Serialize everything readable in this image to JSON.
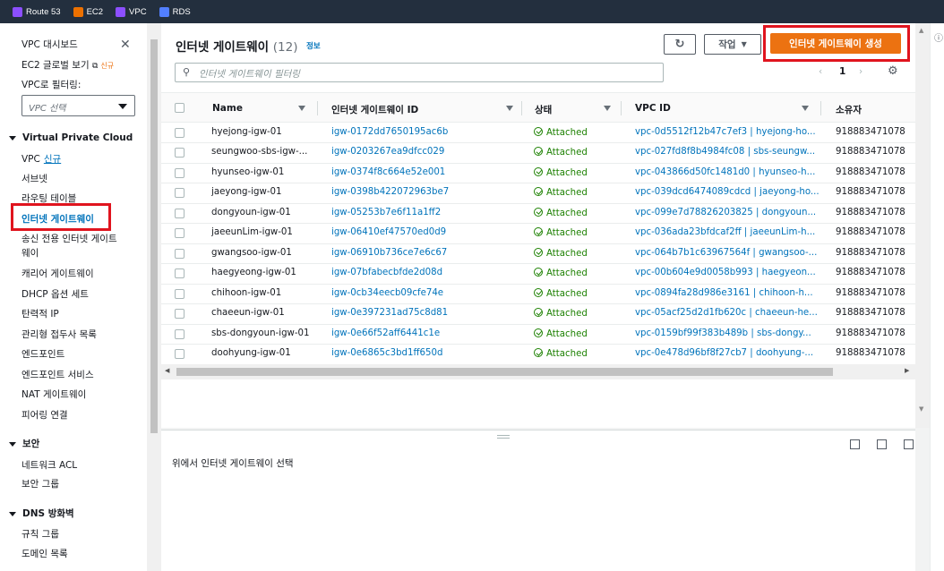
{
  "favorites": [
    {
      "label": "Route 53",
      "color": "#8c4fff",
      "icon": "route53-icon"
    },
    {
      "label": "EC2",
      "color": "#ed7100",
      "icon": "ec2-icon"
    },
    {
      "label": "VPC",
      "color": "#8c4fff",
      "icon": "vpc-icon"
    },
    {
      "label": "RDS",
      "color": "#527fff",
      "icon": "rds-icon"
    }
  ],
  "sidebar": {
    "dashboard": "VPC 대시보드",
    "global_view": "EC2 글로벌 보기",
    "global_view_badge": "신규",
    "filter_label": "VPC로 필터링:",
    "filter_select": "VPC 선택",
    "section_vpc": "Virtual Private Cloud",
    "vpc_item": "VPC",
    "vpc_new": "신규",
    "items_vpc": [
      "서브넷",
      "라우팅 테이블",
      "인터넷 게이트웨이",
      "송신 전용 인터넷 게이트",
      "웨이",
      "캐리어 게이트웨이",
      "DHCP 옵션 세트",
      "탄력적 IP",
      "관리형 접두사 목록",
      "엔드포인트",
      "엔드포인트 서비스",
      "NAT 게이트웨이",
      "피어링 연결"
    ],
    "section_security": "보안",
    "items_security": [
      "네트워크 ACL",
      "보안 그룹"
    ],
    "section_dns": "DNS 방화벽",
    "items_dns": [
      "규칙 그룹",
      "도메인 목록"
    ]
  },
  "header": {
    "title": "인터넷 게이트웨이",
    "count": "(12)",
    "info": "정보",
    "actions_label": "작업",
    "create_label": "인터넷 게이트웨이 생성",
    "search_placeholder": "인터넷 게이트웨이 필터링",
    "page": "1"
  },
  "table": {
    "columns": [
      "Name",
      "인터넷 게이트웨이 ID",
      "상태",
      "VPC ID",
      "소유자"
    ],
    "rows": [
      {
        "name": "hyejong-igw-01",
        "id": "igw-0172dd7650195ac6b",
        "state": "Attached",
        "vpc": "vpc-0d5512f12b47c7ef3 | hyejong-ho...",
        "owner": "918883471078"
      },
      {
        "name": "seungwoo-sbs-igw-...",
        "id": "igw-0203267ea9dfcc029",
        "state": "Attached",
        "vpc": "vpc-027fd8f8b4984fc08 | sbs-seungw...",
        "owner": "918883471078"
      },
      {
        "name": "hyunseo-igw-01",
        "id": "igw-0374f8c664e52e001",
        "state": "Attached",
        "vpc": "vpc-043866d50fc1481d0 | hyunseo-h...",
        "owner": "918883471078"
      },
      {
        "name": "jaeyong-igw-01",
        "id": "igw-0398b422072963be7",
        "state": "Attached",
        "vpc": "vpc-039dcd6474089cdcd | jaeyong-ho...",
        "owner": "918883471078"
      },
      {
        "name": "dongyoun-igw-01",
        "id": "igw-05253b7e6f11a1ff2",
        "state": "Attached",
        "vpc": "vpc-099e7d78826203825 | dongyoun...",
        "owner": "918883471078"
      },
      {
        "name": "jaeeunLim-igw-01",
        "id": "igw-06410ef47570ed0d9",
        "state": "Attached",
        "vpc": "vpc-036ada23bfdcaf2ff | jaeeunLim-h...",
        "owner": "918883471078"
      },
      {
        "name": "gwangsoo-igw-01",
        "id": "igw-06910b736ce7e6c67",
        "state": "Attached",
        "vpc": "vpc-064b7b1c63967564f | gwangsoo-...",
        "owner": "918883471078"
      },
      {
        "name": "haegyeong-igw-01",
        "id": "igw-07bfabecbfde2d08d",
        "state": "Attached",
        "vpc": "vpc-00b604e9d0058b993 | haegyeon...",
        "owner": "918883471078"
      },
      {
        "name": "chihoon-igw-01",
        "id": "igw-0cb34eecb09cfe74e",
        "state": "Attached",
        "vpc": "vpc-0894fa28d986e3161 | chihoon-h...",
        "owner": "918883471078"
      },
      {
        "name": "chaeeun-igw-01",
        "id": "igw-0e397231ad75c8d81",
        "state": "Attached",
        "vpc": "vpc-05acf25d2d1fb620c | chaeeun-he...",
        "owner": "918883471078"
      },
      {
        "name": "sbs-dongyoun-igw-01",
        "id": "igw-0e66f52aff6441c1e",
        "state": "Attached",
        "vpc": "vpc-0159bf99f383b489b | sbs-dongy...",
        "owner": "918883471078"
      },
      {
        "name": "doohyung-igw-01",
        "id": "igw-0e6865c3bd1ff650d",
        "state": "Attached",
        "vpc": "vpc-0e478d96bf8f27cb7 | doohyung-...",
        "owner": "918883471078"
      }
    ]
  },
  "split_panel": {
    "message": "위에서 인터넷 게이트웨이 선택"
  }
}
